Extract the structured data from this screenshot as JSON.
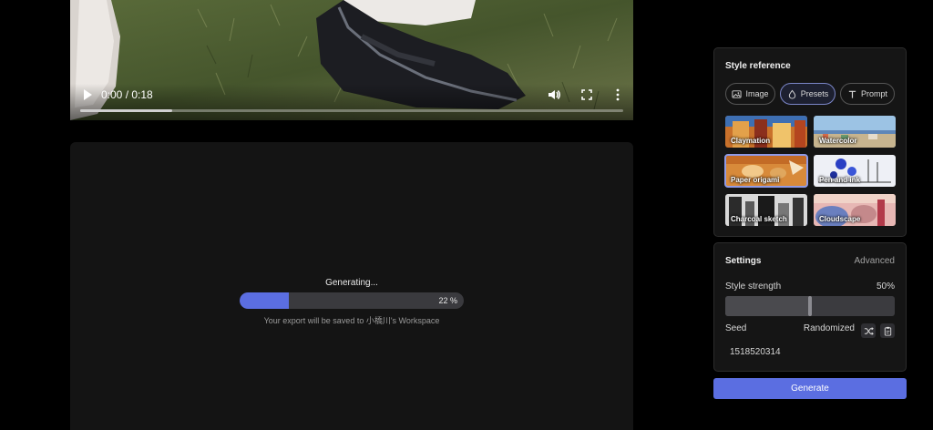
{
  "video": {
    "time": "0:00 / 0:18",
    "progress_fraction": 0.17,
    "icons": [
      "play-icon",
      "volume-icon",
      "fullscreen-icon",
      "more-options-icon"
    ]
  },
  "generation": {
    "status": "Generating...",
    "progress_percent": 22,
    "progress_label": "22 %",
    "note": "Your export will be saved to 小橋川's Workspace"
  },
  "style_reference": {
    "title": "Style reference",
    "tabs": [
      {
        "label": "Image",
        "icon": "image-icon",
        "active": false
      },
      {
        "label": "Presets",
        "icon": "drop-icon",
        "active": true
      },
      {
        "label": "Prompt",
        "icon": "text-icon",
        "active": false
      }
    ],
    "presets": [
      {
        "label": "Claymation",
        "selected": false
      },
      {
        "label": "Watercolor",
        "selected": false
      },
      {
        "label": "Paper origami",
        "selected": true
      },
      {
        "label": "Pen and ink",
        "selected": false
      },
      {
        "label": "Charcoal sketch",
        "selected": false
      },
      {
        "label": "Cloudscape",
        "selected": false
      }
    ]
  },
  "settings": {
    "title": "Settings",
    "advanced_label": "Advanced",
    "style_strength_label": "Style strength",
    "style_strength_value": "50%",
    "style_strength_fraction": 0.5,
    "seed_label": "Seed",
    "seed_mode": "Randomized",
    "seed_value": "1518520314"
  },
  "generate_label": "Generate",
  "colors": {
    "accent": "#5b6ee1",
    "background": "#000000",
    "panel": "#151515"
  }
}
